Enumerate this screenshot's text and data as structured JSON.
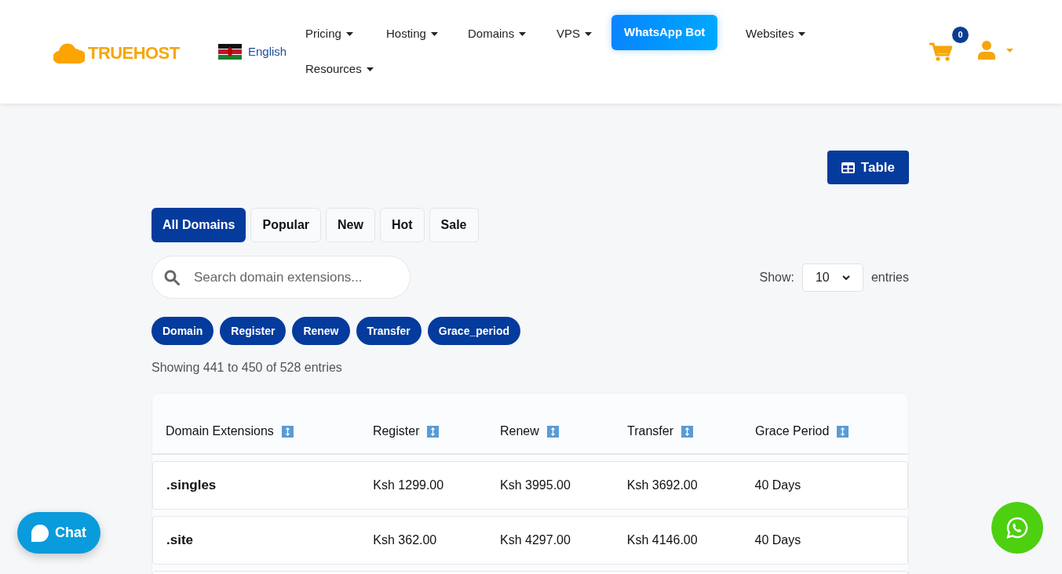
{
  "header": {
    "logo": "TRUEHOST",
    "language": "English",
    "nav": [
      {
        "label": "Pricing",
        "kind": "dropdown"
      },
      {
        "label": "Hosting",
        "kind": "dropdown"
      },
      {
        "label": "Domains",
        "kind": "dropdown"
      },
      {
        "label": "VPS",
        "kind": "dropdown"
      },
      {
        "label": "WhatsApp Bot",
        "kind": "button"
      },
      {
        "label": "Websites",
        "kind": "dropdown"
      },
      {
        "label": "Resources",
        "kind": "dropdown"
      }
    ],
    "cart_count": "0"
  },
  "view_button": "Table",
  "filter_tabs": [
    {
      "label": "All Domains",
      "selected": true
    },
    {
      "label": "Popular",
      "selected": false
    },
    {
      "label": "New",
      "selected": false
    },
    {
      "label": "Hot",
      "selected": false
    },
    {
      "label": "Sale",
      "selected": false
    }
  ],
  "search": {
    "placeholder": "Search domain extensions..."
  },
  "page_size": {
    "label": "Show:",
    "value": "10",
    "suffix": "entries"
  },
  "column_chips": [
    "Domain",
    "Register",
    "Renew",
    "Transfer",
    "Grace_period"
  ],
  "summary": "Showing 441 to 450 of 528 entries",
  "table": {
    "columns": [
      "Domain Extensions",
      "Register",
      "Renew",
      "Transfer",
      "Grace Period"
    ],
    "rows": [
      [
        ".singles",
        "Ksh 1299.00",
        "Ksh 3995.00",
        "Ksh 3692.00",
        "40 Days"
      ],
      [
        ".site",
        "Ksh 362.00",
        "Ksh 4297.00",
        "Ksh 4146.00",
        "40 Days"
      ]
    ]
  },
  "chat_button": "Chat"
}
